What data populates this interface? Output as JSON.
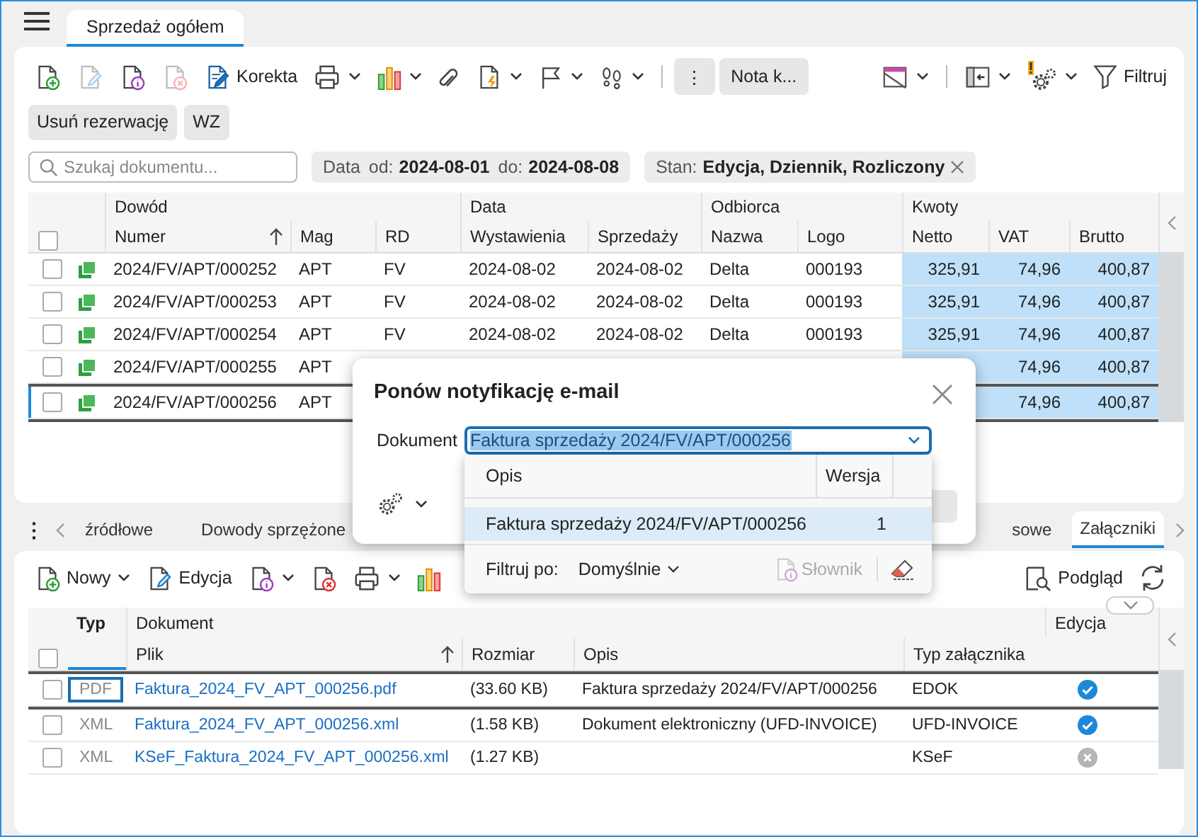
{
  "header_tab": {
    "label": "Sprzedaż ogółem",
    "selected": true
  },
  "toolbar": {
    "left": [
      {
        "kind": "new",
        "disabled": false
      },
      {
        "kind": "edit",
        "disabled": true
      },
      {
        "kind": "info",
        "disabled": false
      },
      {
        "kind": "delete",
        "disabled": true
      },
      {
        "kind": "correction",
        "label": "Korekta",
        "disabled": false
      },
      {
        "kind": "print",
        "disabled": false
      },
      {
        "kind": "chart",
        "disabled": false
      },
      {
        "kind": "attach",
        "disabled": false
      },
      {
        "kind": "lightning",
        "disabled": false
      },
      {
        "kind": "flag",
        "disabled": false
      },
      {
        "kind": "steps",
        "disabled": false
      },
      {
        "kind": "separator"
      },
      {
        "kind": "more",
        "label": "⋮",
        "disabled": false
      },
      {
        "kind": "note",
        "label": "Nota k...",
        "disabled": false
      }
    ],
    "right": [
      {
        "kind": "calendar",
        "disabled": false
      },
      {
        "kind": "separator"
      },
      {
        "kind": "panel",
        "disabled": false
      },
      {
        "kind": "gear",
        "disabled": false
      },
      {
        "kind": "filter",
        "label": "Filtruj",
        "disabled": false
      }
    ]
  },
  "action_buttons": [
    "Usuń rezerwację",
    "WZ"
  ],
  "search": {
    "placeholder": "Szukaj dokumentu..."
  },
  "date_filter": {
    "label": "Data",
    "from_label": "od:",
    "from": "2024-08-01",
    "to_label": "do:",
    "to": "2024-08-08"
  },
  "state_filter": {
    "label": "Stan:",
    "value": "Edycja, Dziennik, Rozliczony"
  },
  "documents": {
    "select_all_checked": false,
    "groups": [
      "Dowód",
      "Data",
      "Odbiorca",
      "Kwoty"
    ],
    "columns": [
      {
        "label": "Numer",
        "sorted": true
      },
      {
        "label": "Mag",
        "sorted": false
      },
      {
        "label": "RD",
        "sorted": false
      },
      {
        "label": "Wystawienia",
        "sorted": false
      },
      {
        "label": "Sprzedaży",
        "sorted": false
      },
      {
        "label": "Nazwa",
        "sorted": false
      },
      {
        "label": "Logo",
        "sorted": false
      },
      {
        "label": "Netto",
        "sorted": false
      },
      {
        "label": "VAT",
        "sorted": false
      },
      {
        "label": "Brutto",
        "sorted": false
      }
    ],
    "rows": [
      {
        "numer": "2024/FV/APT/000252",
        "mag": "APT",
        "rd": "FV",
        "wystawienia": "2024-08-02",
        "sprzedazy": "2024-08-02",
        "nazwa": "Delta",
        "logo": "000193",
        "netto": "325,91",
        "vat": "74,96",
        "brutto": "400,87",
        "checked": false,
        "selected": false
      },
      {
        "numer": "2024/FV/APT/000253",
        "mag": "APT",
        "rd": "FV",
        "wystawienia": "2024-08-02",
        "sprzedazy": "2024-08-02",
        "nazwa": "Delta",
        "logo": "000193",
        "netto": "325,91",
        "vat": "74,96",
        "brutto": "400,87",
        "checked": false,
        "selected": false
      },
      {
        "numer": "2024/FV/APT/000254",
        "mag": "APT",
        "rd": "FV",
        "wystawienia": "2024-08-02",
        "sprzedazy": "2024-08-02",
        "nazwa": "Delta",
        "logo": "000193",
        "netto": "325,91",
        "vat": "74,96",
        "brutto": "400,87",
        "checked": false,
        "selected": false
      },
      {
        "numer": "2024/FV/APT/000255",
        "mag": "APT",
        "vat": "74,96",
        "brutto": "400,87",
        "checked": false,
        "selected": false
      },
      {
        "numer": "2024/FV/APT/000256",
        "mag": "APT",
        "vat": "74,96",
        "brutto": "400,87",
        "checked": false,
        "selected": true
      }
    ]
  },
  "lower_tabs": {
    "more": "⋮",
    "items": [
      {
        "label": "źródłowe",
        "selected": false
      },
      {
        "label": "Dowody sprzężone",
        "selected": false
      },
      {
        "label": "sowe",
        "selected": false
      },
      {
        "label": "Załączniki",
        "selected": true
      }
    ]
  },
  "lower_toolbar": {
    "left": [
      {
        "kind": "new",
        "label": "Nowy"
      },
      {
        "kind": "edit",
        "label": "Edycja"
      },
      {
        "kind": "info"
      },
      {
        "kind": "delete"
      },
      {
        "kind": "print"
      },
      {
        "kind": "chart"
      }
    ],
    "right": [
      {
        "kind": "preview",
        "label": "Podgląd"
      },
      {
        "kind": "refresh"
      }
    ]
  },
  "attachments": {
    "select_all_checked": false,
    "type_header": "Typ",
    "group": "Dokument",
    "columns": [
      {
        "label": "Plik",
        "sorted": true
      },
      {
        "label": "Rozmiar",
        "sorted": false
      },
      {
        "label": "Opis",
        "sorted": false
      },
      {
        "label": "Typ załącznika",
        "sorted": false
      }
    ],
    "edit_header": "Edycja",
    "rows": [
      {
        "type": "PDF",
        "file": "Faktura_2024_FV_APT_000256.pdf",
        "size": "(33.60 KB)",
        "description": "Faktura sprzedaży 2024/FV/APT/000256",
        "attachment_type": "EDOK",
        "edited": true,
        "checked": false,
        "selected": true
      },
      {
        "type": "XML",
        "file": "Faktura_2024_FV_APT_000256.xml",
        "size": "(1.58 KB)",
        "description": "Dokument elektroniczny (UFD-INVOICE)",
        "attachment_type": "UFD-INVOICE",
        "edited": true,
        "checked": false,
        "selected": false
      },
      {
        "type": "XML",
        "file": "KSeF_Faktura_2024_FV_APT_000256.xml",
        "size": "(1.27 KB)",
        "attachment_type": "KSeF",
        "edited": false,
        "checked": false,
        "selected": false
      }
    ]
  },
  "dialog": {
    "title": "Ponów notyfikację e-mail",
    "field_label": "Dokument",
    "value": "Faktura sprzedaży 2024/FV/APT/000256",
    "dropdown": {
      "columns": [
        "Opis",
        "Wersja"
      ],
      "rows": [
        {
          "description": "Faktura sprzedaży 2024/FV/APT/000256",
          "version": "1",
          "selected": true
        }
      ],
      "filter_label": "Filtruj po:",
      "filter_value": "Domyślnie",
      "dictionary": "Słownik",
      "dictionary_disabled": true
    }
  }
}
